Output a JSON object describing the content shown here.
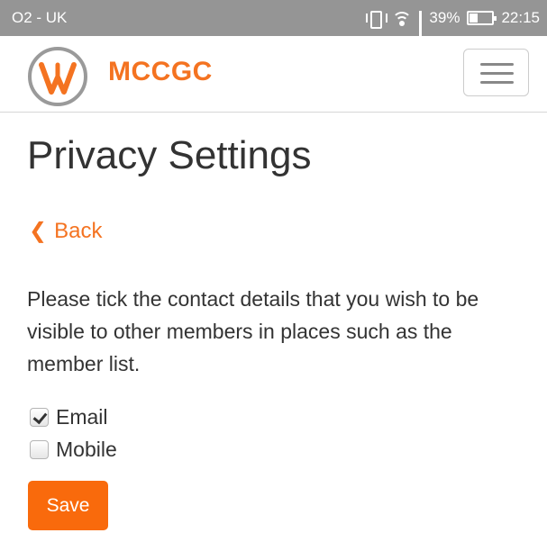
{
  "status_bar": {
    "carrier": "O2 - UK",
    "battery": "39%",
    "battery_level": 0.39,
    "time": "22:15",
    "icons": [
      "vibrate-icon",
      "wifi-icon",
      "signal-icon",
      "battery-icon"
    ]
  },
  "navbar": {
    "brand": "MCCGC",
    "menu_icon": "hamburger-icon"
  },
  "page": {
    "title": "Privacy Settings",
    "back_label": "Back",
    "back_icon": "chevron-left-icon",
    "description": "Please tick the contact details that you wish to be visible to other members in places such as the member list."
  },
  "options": [
    {
      "label": "Email",
      "checked": true
    },
    {
      "label": "Mobile",
      "checked": false
    }
  ],
  "save_label": "Save",
  "colors": {
    "accent": "#f47321",
    "button": "#f96a0c",
    "status_bar": "#959595"
  }
}
